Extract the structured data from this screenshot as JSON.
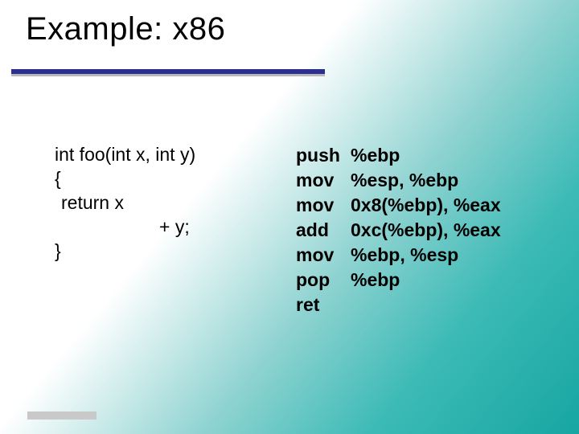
{
  "title": "Example: x86",
  "code": {
    "l1": "int foo(int x, int y)",
    "l2": "{",
    "l3": "return x",
    "l4": "+ y;",
    "l5": "}"
  },
  "asm": [
    {
      "op": "push",
      "args": "%ebp"
    },
    {
      "op": "mov",
      "args": "%esp, %ebp"
    },
    {
      "op": "mov",
      "args": "0x8(%ebp), %eax"
    },
    {
      "op": "add",
      "args": "0xc(%ebp), %eax"
    },
    {
      "op": "mov",
      "args": "%ebp, %esp"
    },
    {
      "op": "pop",
      "args": "%ebp"
    },
    {
      "op": "ret",
      "args": ""
    }
  ]
}
